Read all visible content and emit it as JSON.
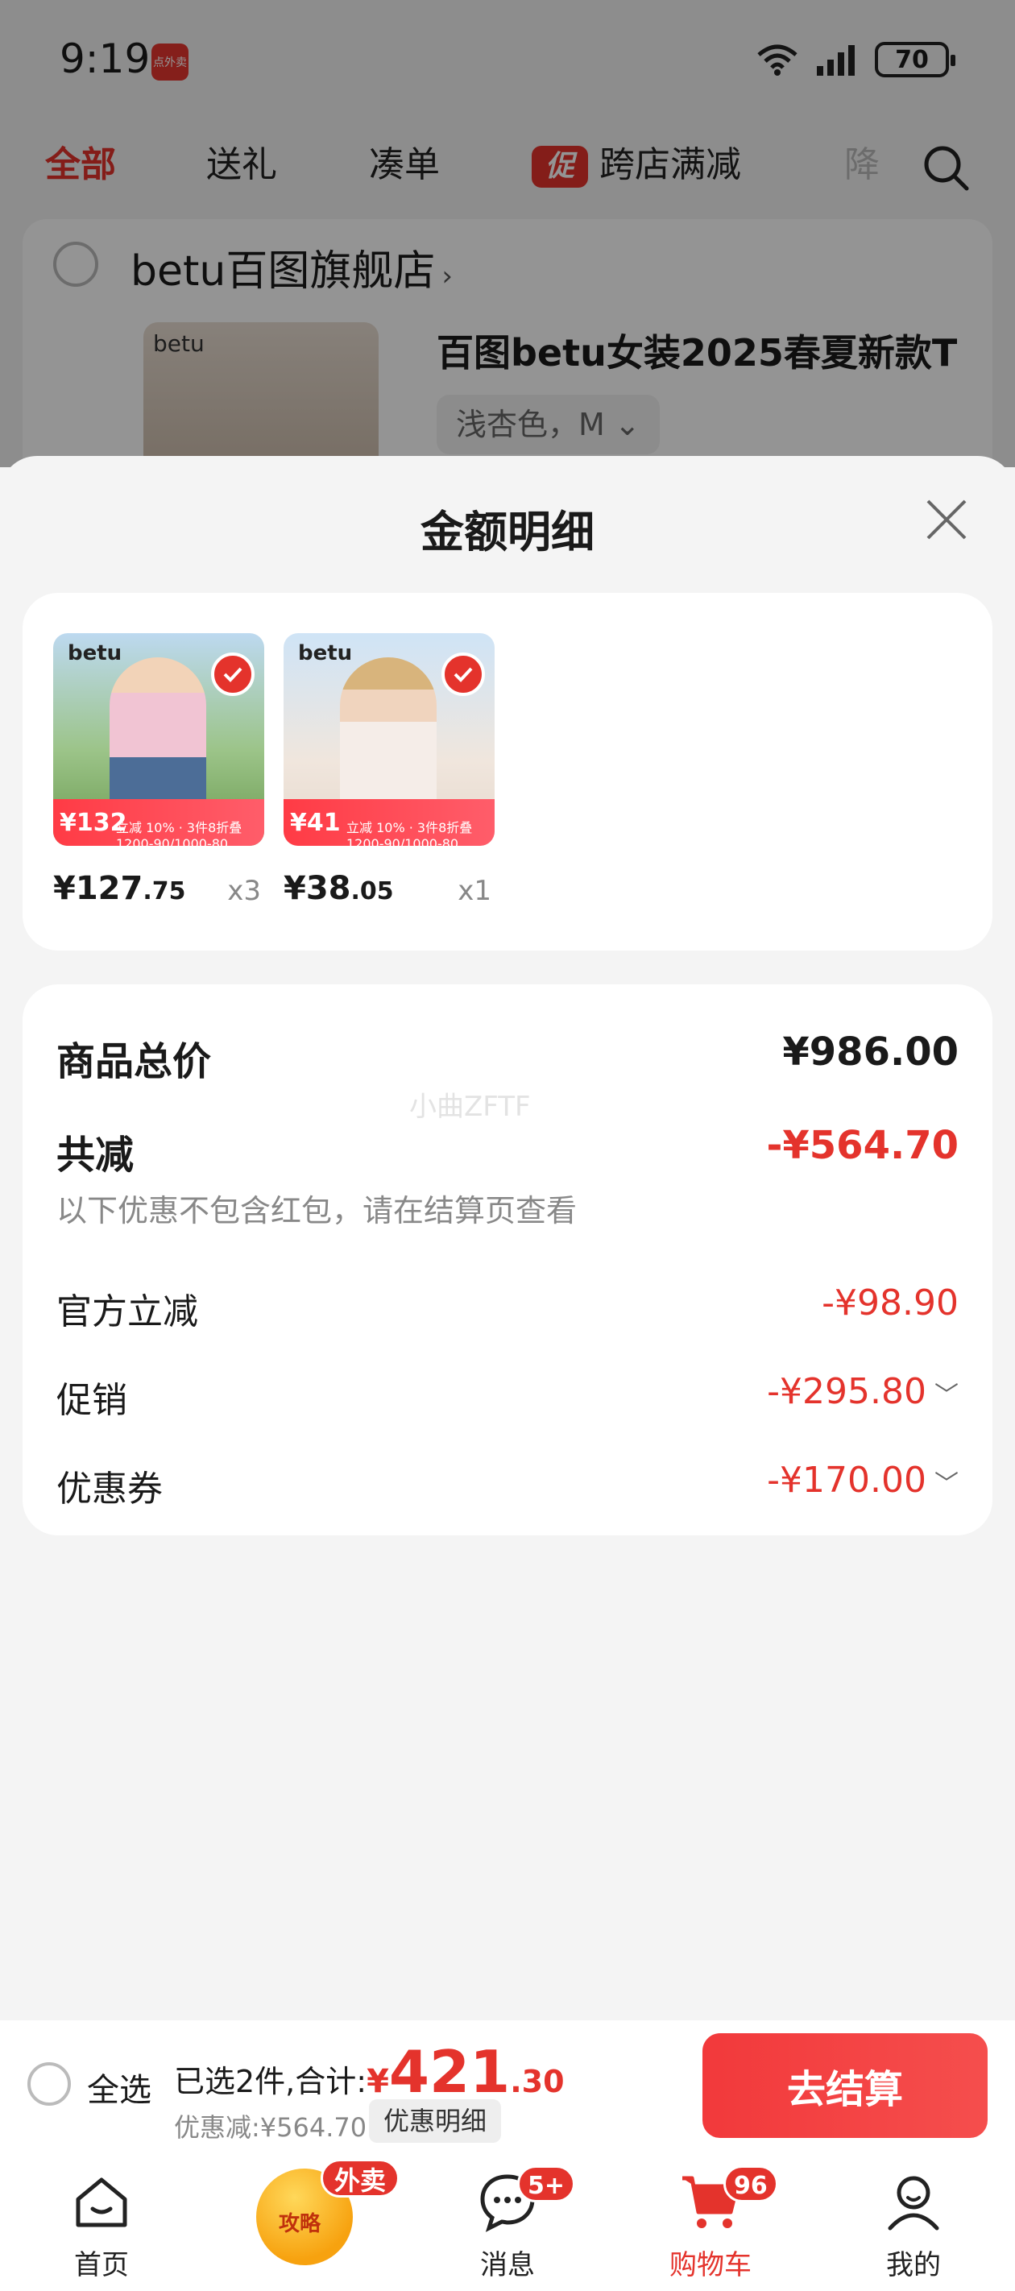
{
  "status_bar": {
    "time": "9:19",
    "app_badge": "点外卖",
    "battery": "70"
  },
  "top_tabs": [
    {
      "label": "全部"
    },
    {
      "label": "送礼"
    },
    {
      "label": "凑单"
    },
    {
      "promo_icon": "促",
      "label": "跨店满减"
    },
    {
      "label": "降"
    }
  ],
  "store": {
    "name": "betu百图旗舰店",
    "chevron": "›",
    "thumb_brand": "betu"
  },
  "background_product": {
    "title": "百图betu女装2025春夏新款T",
    "sku": "浅杏色，M ⌄"
  },
  "sheet": {
    "title": "金额明细",
    "items": [
      {
        "brand": "betu",
        "strip_price": "¥132",
        "strip_text": "立减 10% · 3件8折叠1200-90/1000-80",
        "price_int": "¥127",
        "price_dec": ".75",
        "qty": "x3"
      },
      {
        "brand": "betu",
        "strip_price": "¥41",
        "strip_text": "立减 10% · 3件8折叠1200-90/1000-80",
        "price_int": "¥38",
        "price_dec": ".05",
        "qty": "x1"
      }
    ],
    "summary": {
      "total_label": "商品总价",
      "total_value": "¥986.00",
      "watermark": "小曲ZFTF",
      "reduce_label": "共减",
      "reduce_value": "-¥564.70",
      "reduce_note": "以下优惠不包含红包，请在结算页查看",
      "rows": [
        {
          "label": "官方立减",
          "value": "-¥98.90",
          "expandable": false
        },
        {
          "label": "促销",
          "value": "-¥295.80",
          "expandable": true
        },
        {
          "label": "优惠券",
          "value": "-¥170.00",
          "expandable": true
        }
      ]
    }
  },
  "checkout": {
    "select_all": "全选",
    "selected_prefix": "已选2件,合计:",
    "yen": "¥",
    "total_int": "421",
    "total_dec": ".30",
    "discount_text": "优惠减:¥564.70",
    "detail_chip": "优惠明细",
    "button": "去结算"
  },
  "bottom_nav": [
    {
      "label": "首页",
      "icon": "home-icon"
    },
    {
      "label": "攻略",
      "icon": "strategy-icon",
      "badge": "外卖"
    },
    {
      "label": "消息",
      "icon": "message-icon",
      "badge": "5+"
    },
    {
      "label": "购物车",
      "icon": "cart-icon",
      "badge": "96",
      "active": true
    },
    {
      "label": "我的",
      "icon": "profile-icon"
    }
  ],
  "colors": {
    "accent": "#e4332c",
    "background": "#f4f4f4"
  }
}
